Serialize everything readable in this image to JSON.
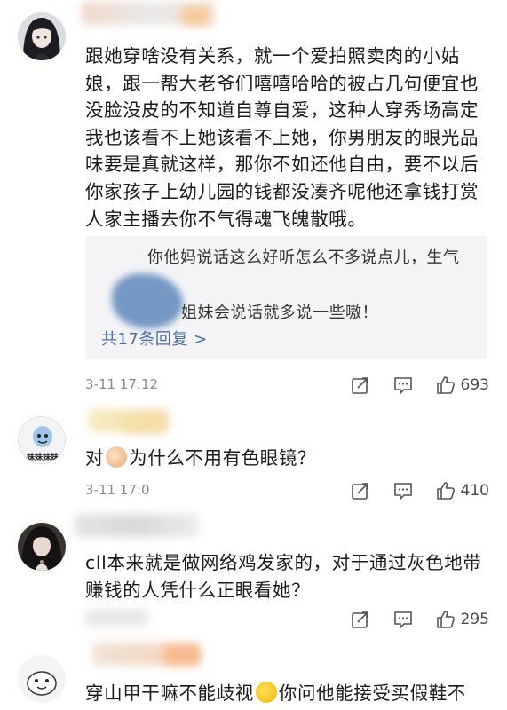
{
  "comments": [
    {
      "avatar_icon": "anime-girl-avatar-icon",
      "text": "跟她穿啥没有关系，就一个爱拍照卖肉的小姑娘，跟一帮大老爷们嘻嘻哈哈的被占几句便宜也没脸没皮的不知道自尊自爱，这种人穿秀场高定我也该看不上她该看不上她，你男朋友的眼光品味要是真就这样，那你不如还他自由，要不以后你家孩子上幼儿园的钱都没凑齐呢他还拿钱打赏人家主播去你不气得魂飞魄散哦。",
      "replies": {
        "line1": "你他妈说话这么好听怎么不多说点儿，生气",
        "line2": "姐妹会说话就多说一些嗷！",
        "more": "共17条回复 >"
      },
      "timestamp": "3-11 17:12",
      "likes": "693"
    },
    {
      "avatar_icon": "meimei-avatar-icon",
      "avatar_label": "妹妹妹妹",
      "text_before": "对",
      "text_after": "为什么不用有色眼镜？",
      "emoji": "hand-emoji-icon",
      "timestamp": "3-11 17:0",
      "likes": "410"
    },
    {
      "avatar_icon": "dark-hair-avatar-icon",
      "text": "cll本来就是做网络鸡发家的，对于通过灰色地带赚钱的人凭什么正眼看她？",
      "likes": "295"
    },
    {
      "avatar_icon": "cartoon-avatar-icon",
      "text_before": "穿山甲干嘛不能歧视",
      "text_after": "你问他能接受买假鞋不",
      "emoji": "grin-emoji-icon"
    }
  ],
  "colors": {
    "text": "#1a1a1a",
    "meta": "#8a8a8a",
    "link": "#4a6fa5",
    "reply_bg": "#f4f4f6"
  }
}
